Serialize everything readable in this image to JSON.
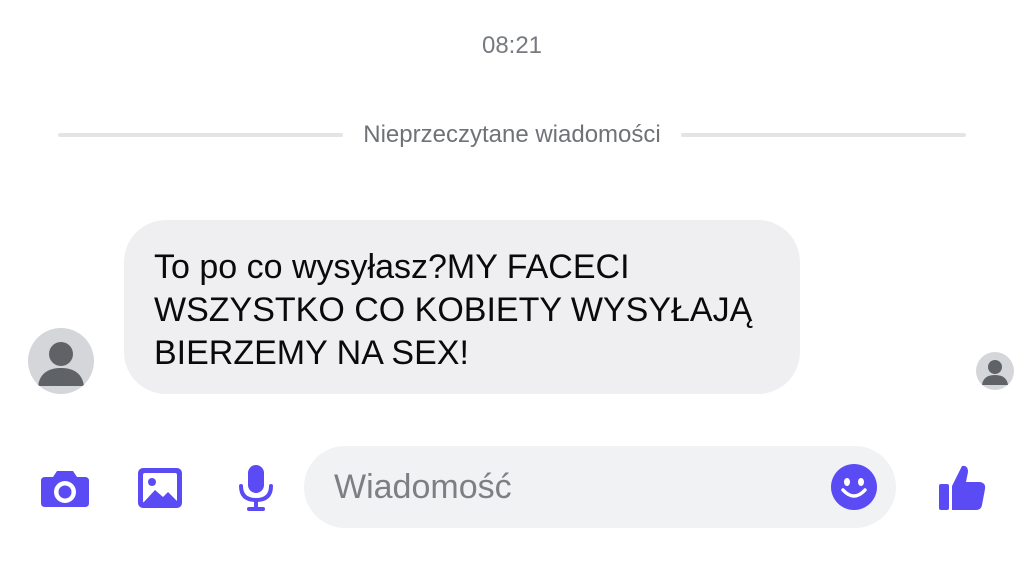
{
  "conversation": {
    "timestamp": "08:21",
    "unread_divider": "Nieprzeczytane wiadomości",
    "messages": [
      {
        "direction": "incoming",
        "text": "To po co wysyłasz?MY FACECI\nWSZYSTKO CO KOBIETY WYSYŁAJĄ\nBIERZEMY NA SEX!"
      }
    ]
  },
  "composer": {
    "placeholder": "Wiadomość",
    "icons": [
      "camera-icon",
      "image-icon",
      "microphone-icon",
      "emoji-icon",
      "thumbs-up-icon"
    ]
  },
  "colors": {
    "accent": "#5b4bf5",
    "bubble": "#efeff1",
    "avatar": "#d4d6d9"
  }
}
